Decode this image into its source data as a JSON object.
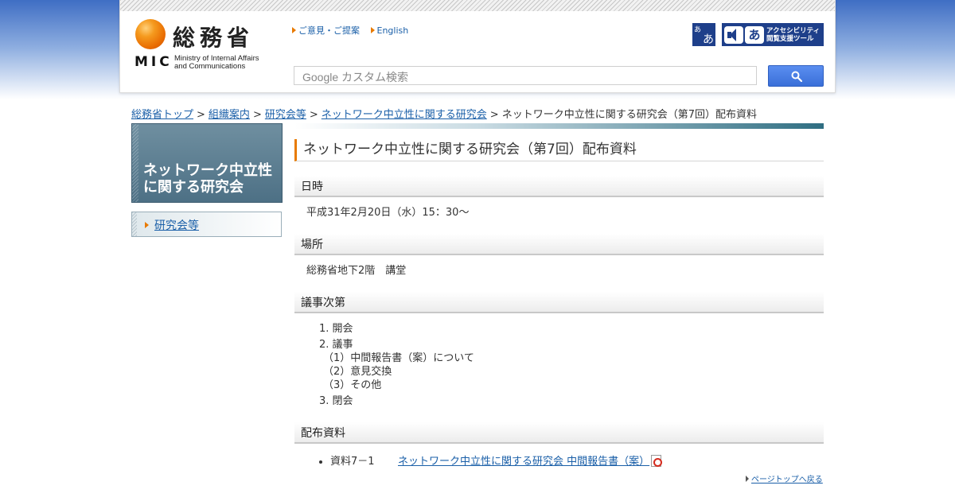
{
  "header": {
    "logo_ja": "総務省",
    "logo_mic": "MIC",
    "logo_en_line1": "Ministry of Internal Affairs",
    "logo_en_line2": "and Communications",
    "link_opinion": "ご意見・ご提案",
    "link_english": "English",
    "font_size_btn_top": "あ",
    "font_size_btn_bottom": "あ",
    "a11y_a": "あ",
    "a11y_line1": "アクセシビリティ",
    "a11y_line2": "閲覧支援ツール",
    "search_placeholder": "Google カスタム検索"
  },
  "breadcrumb": {
    "items": [
      "総務省トップ",
      "組織案内",
      "研究会等",
      "ネットワーク中立性に関する研究会"
    ],
    "current": "ネットワーク中立性に関する研究会（第7回）配布資料",
    "separator": ">"
  },
  "sidebar": {
    "title": "ネットワーク中立性に関する研究会",
    "items": [
      {
        "label": "研究会等"
      }
    ]
  },
  "main": {
    "page_title": "ネットワーク中立性に関する研究会（第7回）配布資料",
    "datetime_heading": "日時",
    "datetime_value": "平成31年2月20日（水）15：30～",
    "place_heading": "場所",
    "place_value": "総務省地下2階　講堂",
    "agenda_heading": "議事次第",
    "agenda": {
      "item1": "1. 開会",
      "item2": "2. 議事",
      "sub1": "（1）中間報告書（案）について",
      "sub2": "（2）意見交換",
      "sub3": "（3）その他",
      "item3": "3. 閉会"
    },
    "docs_heading": "配布資料",
    "docs": [
      {
        "label": "資料7－1",
        "title": "ネットワーク中立性に関する研究会 中間報告書（案）"
      }
    ],
    "pagetop": "ページトップへ戻る"
  },
  "colors": {
    "accent": "#e87a00",
    "link": "#1a5fa8",
    "sidebar_title_bg": "#5a7c90",
    "a11y_bg": "#1e3f8a"
  },
  "icons": [
    "search-icon",
    "pdf-icon",
    "arrow-right-icon",
    "speaker-icon"
  ]
}
